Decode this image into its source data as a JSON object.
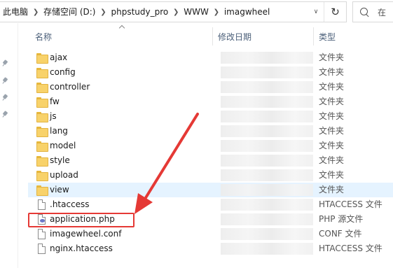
{
  "breadcrumb": {
    "items": [
      "此电脑",
      "存储空间 (D:)",
      "phpstudy_pro",
      "WWW",
      "imagwheel"
    ]
  },
  "search": {
    "placeholder": "在"
  },
  "columns": {
    "name": "名称",
    "date": "修改日期",
    "type": "类型"
  },
  "files": [
    {
      "name": "ajax",
      "type": "文件夹",
      "kind": "folder"
    },
    {
      "name": "config",
      "type": "文件夹",
      "kind": "folder"
    },
    {
      "name": "controller",
      "type": "文件夹",
      "kind": "folder"
    },
    {
      "name": "fw",
      "type": "文件夹",
      "kind": "folder"
    },
    {
      "name": "js",
      "type": "文件夹",
      "kind": "folder"
    },
    {
      "name": "lang",
      "type": "文件夹",
      "kind": "folder"
    },
    {
      "name": "model",
      "type": "文件夹",
      "kind": "folder"
    },
    {
      "name": "style",
      "type": "文件夹",
      "kind": "folder"
    },
    {
      "name": "upload",
      "type": "文件夹",
      "kind": "folder"
    },
    {
      "name": "view",
      "type": "文件夹",
      "kind": "folder",
      "hover": true
    },
    {
      "name": ".htaccess",
      "type": "HTACCESS 文件",
      "kind": "file"
    },
    {
      "name": "application.php",
      "type": "PHP 源文件",
      "kind": "php",
      "highlighted": true
    },
    {
      "name": "imagewheel.conf",
      "type": "CONF 文件",
      "kind": "file"
    },
    {
      "name": "nginx.htaccess",
      "type": "HTACCESS 文件",
      "kind": "file"
    }
  ],
  "colors": {
    "annotation": "#e53935",
    "hover_row": "#e5f3ff",
    "folder": "#f8d26a"
  }
}
